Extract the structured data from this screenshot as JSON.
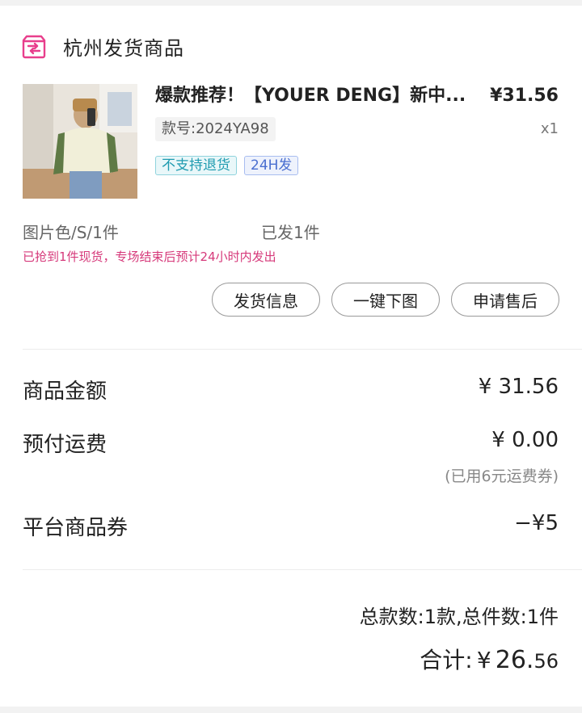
{
  "store": {
    "name": "杭州发货商品",
    "icon": "store-box-icon",
    "accent": "#e83e8c"
  },
  "product": {
    "title": "爆款推荐！【YOUER DENG】新中...",
    "price": "¥31.56",
    "code": "款号:2024YA98",
    "quantity": "x1",
    "tags": [
      "不支持退货",
      "24H发"
    ],
    "spec": "图片色/S/1件",
    "shipped": "已发1件",
    "notice": "已抢到1件现货，专场结束后预计24小时内发出"
  },
  "actions": {
    "shipping_info": "发货信息",
    "download_images": "一键下图",
    "after_sale": "申请售后"
  },
  "costs": {
    "goods_label": "商品金额",
    "goods_value": "¥ 31.56",
    "shipping_label": "预付运费",
    "shipping_value": "¥ 0.00",
    "shipping_note": "(已用6元运费券)",
    "coupon_label": "平台商品券",
    "coupon_value": "−¥5"
  },
  "summary": {
    "counts": "总款数:1款,总件数:1件",
    "total_label": "合计:",
    "total_currency": "¥",
    "total_integer": "26.",
    "total_decimal": "56"
  }
}
